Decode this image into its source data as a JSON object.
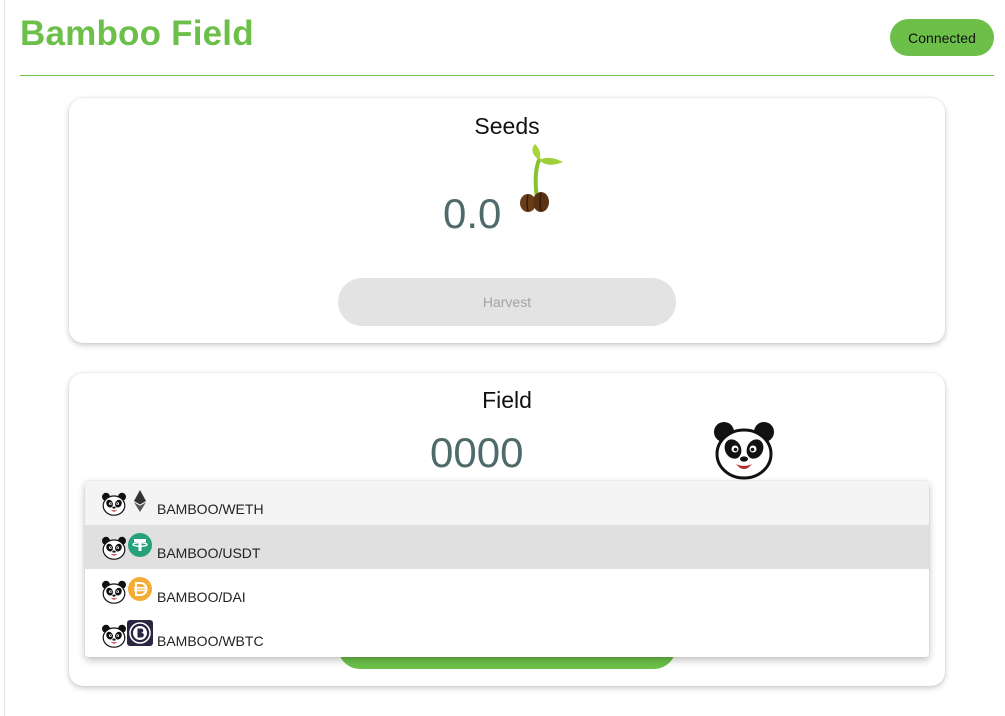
{
  "header": {
    "app_title": "Bamboo Field",
    "status_label": "Connected"
  },
  "colors": {
    "brand_green": "#6cc04a",
    "value_text": "#4f6a6a",
    "button_disabled": "#e3e3e3"
  },
  "seeds": {
    "title": "Seeds",
    "value": "0.0",
    "icon": "seed-sprout-icon",
    "harvest_label": "Harvest",
    "harvest_enabled": false
  },
  "field": {
    "title": "Field",
    "value": "0000",
    "icon": "panda-icon"
  },
  "pair_dropdown": {
    "selected": "BAMBOO/USDT",
    "options": [
      {
        "label": "BAMBOO/WETH",
        "icon": "ethereum-icon"
      },
      {
        "label": "BAMBOO/USDT",
        "icon": "tether-icon"
      },
      {
        "label": "BAMBOO/DAI",
        "icon": "dai-icon"
      },
      {
        "label": "BAMBOO/WBTC",
        "icon": "wbtc-icon"
      }
    ]
  }
}
